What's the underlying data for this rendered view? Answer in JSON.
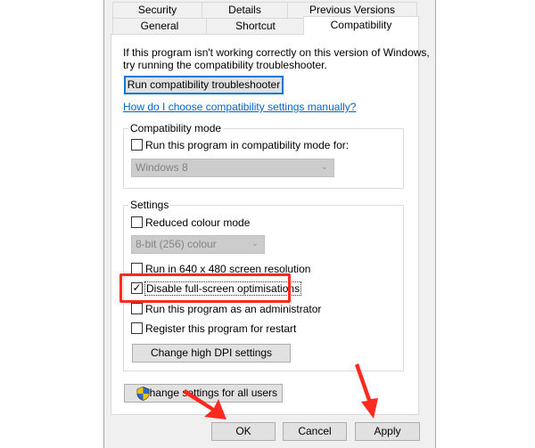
{
  "tabs_row1": [
    "Security",
    "Details",
    "Previous Versions"
  ],
  "tabs_row2": [
    "General",
    "Shortcut",
    "Compatibility"
  ],
  "active_tab": "Compatibility",
  "intro_line1": "If this program isn't working correctly on this version of Windows,",
  "intro_line2": "try running the compatibility troubleshooter.",
  "troubleshooter_button": "Run compatibility troubleshooter",
  "help_link": "How do I choose compatibility settings manually?",
  "compat_mode": {
    "label": "Compatibility mode",
    "checkbox": "Run this program in compatibility mode for:",
    "checked": false,
    "dropdown": "Windows 8"
  },
  "settings": {
    "label": "Settings",
    "reduced_colour": {
      "label": "Reduced colour mode",
      "checked": false
    },
    "colour_dropdown": "8-bit (256) colour",
    "res640": {
      "label": "Run in 640 x 480 screen resolution",
      "checked": false
    },
    "disable_fso": {
      "label": "Disable full-screen optimisations",
      "checked": true
    },
    "admin": {
      "label": "Run this program as an administrator",
      "checked": false
    },
    "restart": {
      "label": "Register this program for restart",
      "checked": false
    },
    "dpi_button": "Change high DPI settings"
  },
  "all_users_button": "Change settings for all users",
  "footer": {
    "ok": "OK",
    "cancel": "Cancel",
    "apply": "Apply"
  },
  "colors": {
    "highlight": "#ff2a1f",
    "accent": "#0078d7",
    "link": "#0066cc"
  }
}
